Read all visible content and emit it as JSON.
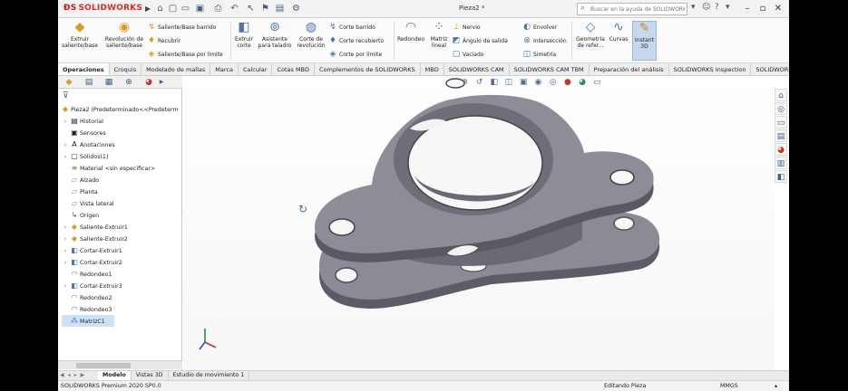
{
  "app": {
    "logo_text": "SOLIDWORKS",
    "doc_title": "Pieza2 *",
    "search_placeholder": "Buscar en la ayuda de SOLIDWORKS"
  },
  "ribbon": {
    "extrude_boss": "Extruir saliente/base",
    "revolve_boss": "Revolución de saliente/base",
    "swept_boss": "Saliente/Base barrido",
    "loft_boss": "Recubrir",
    "boundary_boss": "Saliente/Base por límite",
    "extrude_cut": "Extruir corte",
    "hole_wizard": "Asistente para taladro",
    "revolve_cut": "Corte de revolución",
    "swept_cut": "Corte barrido",
    "loft_cut": "Corte recubierto",
    "boundary_cut": "Corte por límite",
    "fillet": "Redondeo",
    "linear_pattern": "Matriz lineal",
    "rib": "Nervio",
    "draft": "Ángulo de salida",
    "shell": "Vaciado",
    "wrap": "Envolver",
    "intersect": "Intersección",
    "mirror": "Simetría",
    "ref_geometry": "Geometría de refer...",
    "curves": "Curvas",
    "instant3d": "Instant 3D"
  },
  "tabs": [
    "Operaciones",
    "Croquis",
    "Modelado de mallas",
    "Marca",
    "Calcular",
    "Cotas MBD",
    "Complementos de SOLIDWORKS",
    "MBD",
    "SOLIDWORKS CAM",
    "SOLIDWORKS CAM TBM",
    "Preparación del análisis",
    "SOLIDWORKS Inspection",
    "SOLIDWORKS Plastics"
  ],
  "tree": {
    "root": "Pieza2  (Predeterminado<<Predeterm",
    "items": [
      "Historial",
      "Sensores",
      "Anotaciones",
      "Sólidos(1)",
      "Material <sin especificar>",
      "Alzado",
      "Planta",
      "Vista lateral",
      "Origen",
      "Saliente-Extruir1",
      "Saliente-Extruir2",
      "Cortar-Extruir1",
      "Cortar-Extruir2",
      "Redondeo1",
      "Cortar-Extruir3",
      "Redondeo2",
      "Redondeo3",
      "MatrizC1"
    ]
  },
  "bottom_tabs": [
    "Modelo",
    "Vistas 3D",
    "Estudio de movimiento 1"
  ],
  "status": {
    "version": "SOLIDWORKS Premium 2020 SP0.0",
    "mode": "Editando Pieza",
    "units": "MMGS"
  },
  "colors": {
    "accent": "#3f5e86",
    "selection": "#cde1f7",
    "model_top": "#8b8b95",
    "model_side": "#5c5c66"
  }
}
